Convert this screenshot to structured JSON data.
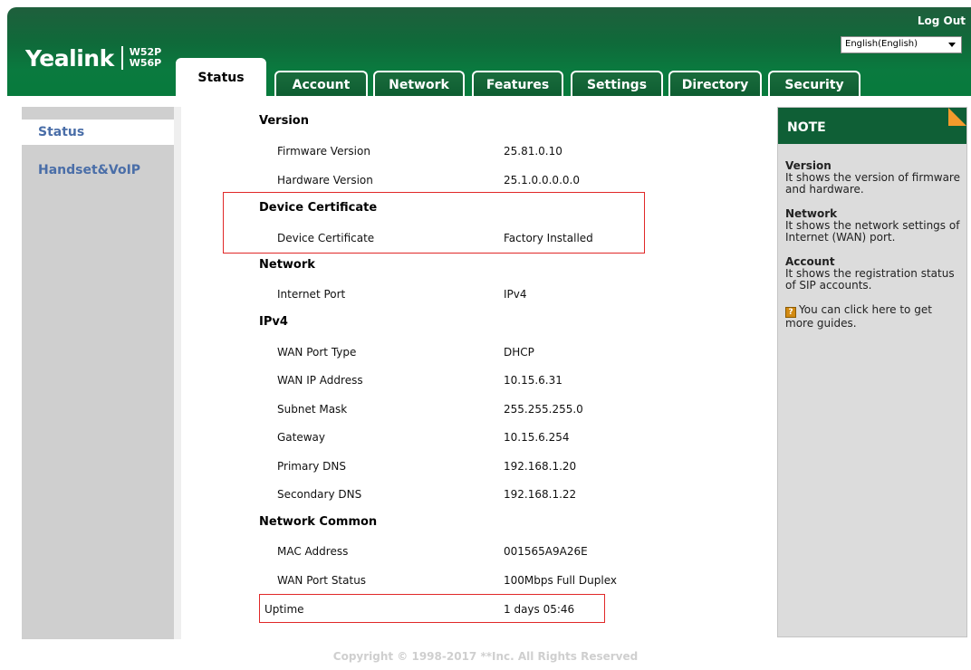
{
  "brand": {
    "name": "Yealink",
    "model1": "W52P",
    "model2": "W56P"
  },
  "header": {
    "logout": "Log Out",
    "language": "English(English)"
  },
  "tabs": [
    {
      "label": "Status",
      "active": true
    },
    {
      "label": "Account",
      "active": false
    },
    {
      "label": "Network",
      "active": false
    },
    {
      "label": "Features",
      "active": false
    },
    {
      "label": "Settings",
      "active": false
    },
    {
      "label": "Directory",
      "active": false
    },
    {
      "label": "Security",
      "active": false
    }
  ],
  "sidebar": {
    "items": [
      {
        "label": "Status",
        "active": true
      },
      {
        "label": "Handset&VoIP",
        "active": false
      }
    ]
  },
  "status": {
    "version": {
      "title": "Version",
      "firmware_label": "Firmware Version",
      "firmware_value": "25.81.0.10",
      "hardware_label": "Hardware Version",
      "hardware_value": "25.1.0.0.0.0.0"
    },
    "certificate": {
      "title": "Device Certificate",
      "cert_label": "Device Certificate",
      "cert_value": "Factory Installed"
    },
    "network": {
      "title": "Network",
      "port_label": "Internet Port",
      "port_value": "IPv4"
    },
    "ipv4": {
      "title": "IPv4",
      "wan_type_label": "WAN Port Type",
      "wan_type_value": "DHCP",
      "wan_ip_label": "WAN IP Address",
      "wan_ip_value": "10.15.6.31",
      "subnet_label": "Subnet Mask",
      "subnet_value": "255.255.255.0",
      "gateway_label": "Gateway",
      "gateway_value": "10.15.6.254",
      "dns1_label": "Primary DNS",
      "dns1_value": "192.168.1.20",
      "dns2_label": "Secondary DNS",
      "dns2_value": "192.168.1.22"
    },
    "common": {
      "title": "Network Common",
      "mac_label": "MAC Address",
      "mac_value": "001565A9A26E",
      "wan_status_label": "WAN Port Status",
      "wan_status_value": "100Mbps Full Duplex",
      "uptime_label": "Uptime",
      "uptime_value": "1 days 05:46"
    }
  },
  "note": {
    "title": "NOTE",
    "version_title": "Version",
    "version_text": "It shows the version of firmware and hardware.",
    "network_title": "Network",
    "network_text": "It shows the network settings of Internet (WAN) port.",
    "account_title": "Account",
    "account_text": "It shows the registration status of SIP accounts.",
    "guide_icon": "?",
    "guide_text": "You can click here to get more guides."
  },
  "footer": {
    "copyright": "Copyright © 1998-2017 **Inc. All Rights Reserved"
  },
  "colors": {
    "header_green": "#0f6a3a",
    "highlight_red": "#e02828",
    "sidebar_link": "#4a6ea8",
    "note_orange": "#f39a2c"
  }
}
